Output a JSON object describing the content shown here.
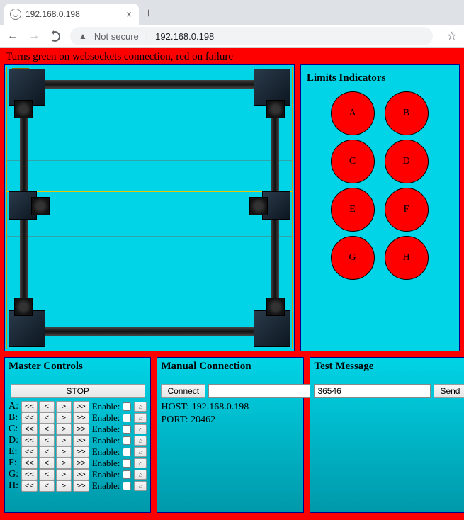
{
  "browser": {
    "tab_title": "192.168.0.198",
    "security_label": "Not secure",
    "url": "192.168.0.198"
  },
  "banner_text": "Turns green on websockets connection, red on failure",
  "limits": {
    "title": "Limits Indicators",
    "leds": [
      "A",
      "B",
      "C",
      "D",
      "E",
      "F",
      "G",
      "H"
    ]
  },
  "master": {
    "title": "Master Controls",
    "stop_label": "STOP",
    "rewind_fast": "<<",
    "rewind": "<",
    "forward": ">",
    "forward_fast": ">>",
    "enable_label": "Enable:",
    "home_icon": "⌂",
    "axes": [
      "A",
      "B",
      "C",
      "D",
      "E",
      "F",
      "G",
      "H"
    ]
  },
  "manual": {
    "title": "Manual Connection",
    "connect_label": "Connect",
    "host_label": "HOST:",
    "host_value": "192.168.0.198",
    "port_label": "PORT:",
    "port_value": "20462",
    "input_value": ""
  },
  "test": {
    "title": "Test Message",
    "value": "36546",
    "send_label": "Send"
  }
}
